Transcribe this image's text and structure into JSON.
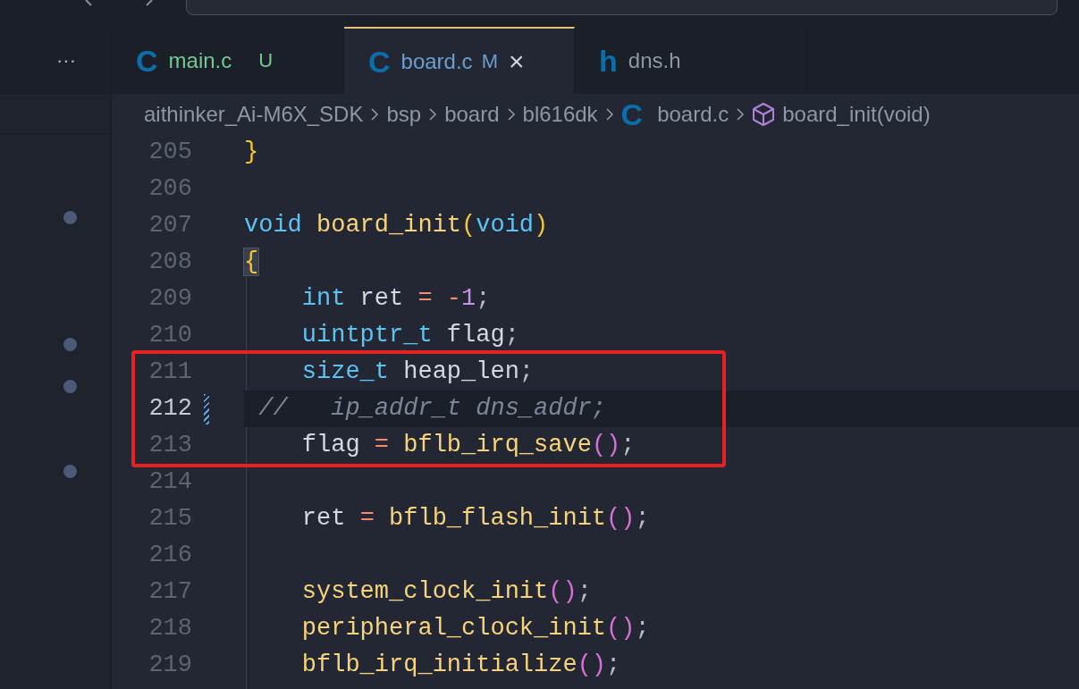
{
  "tabs_overflow": "···",
  "tabs": [
    {
      "icon": "C",
      "label": "main.c",
      "status": "U",
      "kind": "untracked",
      "selected": false
    },
    {
      "icon": "C",
      "label": "board.c",
      "status": "M",
      "kind": "modified",
      "selected": true,
      "close": "×"
    },
    {
      "icon": "h",
      "label": "dns.h",
      "kind": "clean",
      "selected": false
    }
  ],
  "breadcrumb": [
    {
      "label": "aithinker_Ai-M6X_SDK",
      "kind": "folder"
    },
    {
      "label": "bsp",
      "kind": "folder"
    },
    {
      "label": "board",
      "kind": "folder"
    },
    {
      "label": "bl616dk",
      "kind": "folder"
    },
    {
      "label": "board.c",
      "icon": "C",
      "kind": "file"
    },
    {
      "label": "board_init(void)",
      "kind": "symbol"
    }
  ],
  "lines": [
    {
      "number": "205",
      "current": false,
      "modified": false,
      "boxed": false,
      "tokens": [
        {
          "text": "}",
          "kind": "brace"
        }
      ]
    },
    {
      "number": "206",
      "current": false,
      "modified": false,
      "boxed": false
    },
    {
      "number": "207",
      "current": false,
      "modified": false,
      "boxed": false,
      "tokens": [
        {
          "text": "void ",
          "kind": "keyword"
        },
        {
          "text": "board_init",
          "kind": "function"
        },
        {
          "text": "(",
          "kind": "brace"
        },
        {
          "text": "void",
          "kind": "keyword"
        },
        {
          "text": ")",
          "kind": "brace"
        }
      ]
    },
    {
      "number": "208",
      "current": false,
      "modified": false,
      "boxed": false,
      "tokens": [
        {
          "text": "{",
          "kind": "brace",
          "matched": true
        }
      ]
    },
    {
      "number": "209",
      "current": false,
      "modified": false,
      "boxed": false,
      "tokens": [
        {
          "text": "    int",
          "kind": "keyword"
        },
        {
          "text": " ret ",
          "kind": "plain"
        },
        {
          "text": "= -",
          "kind": "operator"
        },
        {
          "text": "1",
          "kind": "number"
        },
        {
          "text": ";",
          "kind": "punct"
        }
      ]
    },
    {
      "number": "210",
      "current": false,
      "modified": false,
      "boxed": false,
      "tokens": [
        {
          "text": "    uintptr_t",
          "kind": "keyword"
        },
        {
          "text": " flag",
          "kind": "plain"
        },
        {
          "text": ";",
          "kind": "punct"
        }
      ]
    },
    {
      "number": "211",
      "current": false,
      "modified": false,
      "boxed": true,
      "tokens": [
        {
          "text": "    size_t",
          "kind": "keyword"
        },
        {
          "text": " heap_len",
          "kind": "plain"
        },
        {
          "text": ";",
          "kind": "punct"
        }
      ]
    },
    {
      "number": "212",
      "current": true,
      "modified": true,
      "boxed": true,
      "tokens": [
        {
          "text": " //   ip_addr_t dns_addr;",
          "kind": "comment"
        }
      ]
    },
    {
      "number": "213",
      "current": false,
      "modified": false,
      "boxed": true,
      "tokens": [
        {
          "text": "    flag ",
          "kind": "plain"
        },
        {
          "text": "= ",
          "kind": "operator"
        },
        {
          "text": "bflb_irq_save",
          "kind": "function"
        },
        {
          "text": "()",
          "kind": "paren"
        },
        {
          "text": ";",
          "kind": "punct"
        }
      ]
    },
    {
      "number": "214",
      "current": false,
      "modified": false,
      "boxed": false
    },
    {
      "number": "215",
      "current": false,
      "modified": false,
      "boxed": false,
      "tokens": [
        {
          "text": "    ret ",
          "kind": "plain"
        },
        {
          "text": "= ",
          "kind": "operator"
        },
        {
          "text": "bflb_flash_init",
          "kind": "function"
        },
        {
          "text": "()",
          "kind": "paren"
        },
        {
          "text": ";",
          "kind": "punct"
        }
      ]
    },
    {
      "number": "216",
      "current": false,
      "modified": false,
      "boxed": false
    },
    {
      "number": "217",
      "current": false,
      "modified": false,
      "boxed": false,
      "tokens": [
        {
          "text": "    system_clock_init",
          "kind": "function"
        },
        {
          "text": "()",
          "kind": "paren"
        },
        {
          "text": ";",
          "kind": "punct"
        }
      ]
    },
    {
      "number": "218",
      "current": false,
      "modified": false,
      "boxed": false,
      "tokens": [
        {
          "text": "    peripheral_clock_init",
          "kind": "function"
        },
        {
          "text": "()",
          "kind": "paren"
        },
        {
          "text": ";",
          "kind": "punct"
        }
      ]
    },
    {
      "number": "219",
      "current": false,
      "modified": false,
      "boxed": false,
      "tokens": [
        {
          "text": "    bflb_irq_initialize",
          "kind": "function"
        },
        {
          "text": "()",
          "kind": "paren"
        },
        {
          "text": ";",
          "kind": "punct"
        }
      ]
    }
  ]
}
